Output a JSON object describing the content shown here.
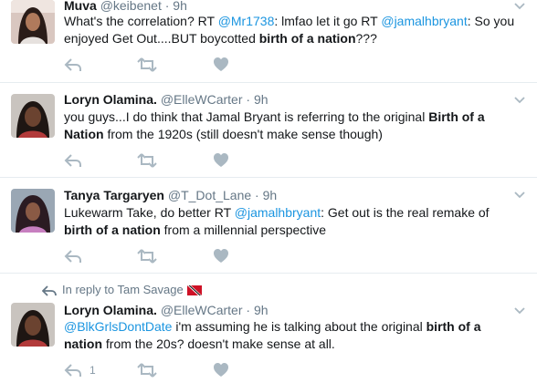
{
  "tweets": [
    {
      "name": "Muva",
      "handle": "@keibenet",
      "time": "9h",
      "text": [
        {
          "t": "What's the correlation? RT "
        },
        {
          "t": "@Mr1738",
          "link": true
        },
        {
          "t": ": lmfao let it go  RT "
        },
        {
          "t": "@jamalhbryant",
          "link": true
        },
        {
          "t": ": So you enjoyed Get Out....BUT boycotted "
        },
        {
          "t": "birth of a nation",
          "bold": true
        },
        {
          "t": "???"
        }
      ]
    },
    {
      "name": "Loryn Olamina.",
      "handle": "@ElleWCarter",
      "time": "9h",
      "text": [
        {
          "t": "you guys...I do think that Jamal Bryant is referring to the original "
        },
        {
          "t": "Birth of a Nation",
          "bold": true
        },
        {
          "t": " from the 1920s (still doesn't make sense though)"
        }
      ]
    },
    {
      "name": "Tanya Targaryen",
      "handle": "@T_Dot_Lane",
      "time": "9h",
      "text": [
        {
          "t": "Lukewarm Take, do better RT "
        },
        {
          "t": "@jamalhbryant",
          "link": true
        },
        {
          "t": ": Get out is the real remake of "
        },
        {
          "t": "birth of a nation",
          "bold": true
        },
        {
          "t": " from a millennial perspective"
        }
      ]
    },
    {
      "reply_context": "In reply to Tam Savage",
      "name": "Loryn Olamina.",
      "handle": "@ElleWCarter",
      "time": "9h",
      "reply_count": "1",
      "text": [
        {
          "t": "@BlkGrlsDontDate",
          "link": true
        },
        {
          "t": " i'm assuming he is talking about the original "
        },
        {
          "t": "birth of a nation",
          "bold": true
        },
        {
          "t": " from the 20s? doesn't make sense at all."
        }
      ]
    }
  ],
  "icons": {
    "reply": "reply-icon",
    "retweet": "retweet-icon",
    "like": "heart-icon",
    "more": "chevron-down-icon"
  },
  "colors": {
    "link": "#1b95e0",
    "meta": "#657786",
    "icon": "#aab8c2",
    "divider": "#e6ecf0"
  }
}
